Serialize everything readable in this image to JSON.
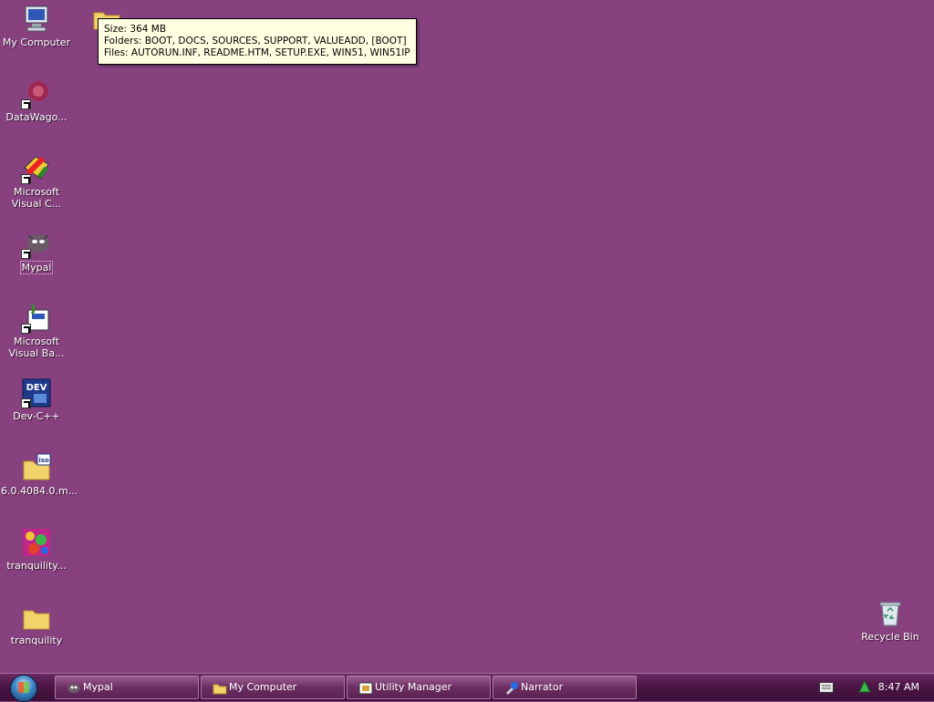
{
  "desktop": {
    "background_color": "#87417F",
    "icons": [
      {
        "label": "My Computer",
        "icon": "my-computer-icon"
      },
      {
        "label": "DataWago...",
        "icon": "datawagon-icon"
      },
      {
        "label": "Microsoft Visual C...",
        "icon": "visual-c-icon"
      },
      {
        "label": "Mypal",
        "icon": "mypal-icon"
      },
      {
        "label": "Microsoft Visual Ba...",
        "icon": "visual-basic-icon"
      },
      {
        "label": "Dev-C++",
        "icon": "dev-cpp-icon"
      },
      {
        "label": "6.0.4084.0.m...",
        "icon": "iso-file-icon"
      },
      {
        "label": "tranquility...",
        "icon": "tranquility-image-icon"
      },
      {
        "label": "tranquility",
        "icon": "folder-icon"
      },
      {
        "label": "Recycle Bin",
        "icon": "recycle-bin-icon"
      }
    ]
  },
  "tooltip": {
    "size": "Size: 364 MB",
    "folders": "Folders: BOOT, DOCS, SOURCES, SUPPORT, VALUEADD, [BOOT]",
    "files": "Files: AUTORUN.INF, README.HTM, SETUP.EXE, WIN51, WIN51IP, ..."
  },
  "taskbar": {
    "buttons": [
      {
        "label": "Mypal",
        "icon": "mypal-icon"
      },
      {
        "label": "My Computer",
        "icon": "folder-icon"
      },
      {
        "label": "Utility Manager",
        "icon": "utility-manager-icon"
      },
      {
        "label": "Narrator",
        "icon": "narrator-icon"
      }
    ],
    "clock": "8:47 AM"
  }
}
